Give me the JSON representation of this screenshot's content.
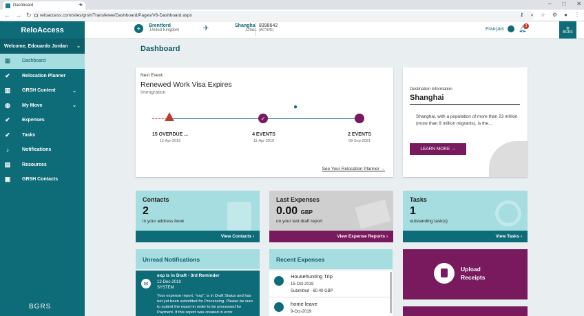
{
  "browser": {
    "tab_title": "Dashboard",
    "url": "reloaccess.com/sites/grsh/Transferee/Dashboard/Pages/V6-Dashboard.aspx"
  },
  "sidebar": {
    "brand": "ReloAccess",
    "welcome": "Welcome, Edouardo Jordan",
    "items": [
      {
        "label": "Dashboard",
        "icon": "dashboard-icon"
      },
      {
        "label": "Relocation Planner",
        "icon": "check-circle-icon"
      },
      {
        "label": "GRSH Content",
        "icon": "books-icon"
      },
      {
        "label": "My Move",
        "icon": "globe-icon"
      },
      {
        "label": "Expenses",
        "icon": "check-circle-icon"
      },
      {
        "label": "Tasks",
        "icon": "check-circle-icon"
      },
      {
        "label": "Notifications",
        "icon": "bell-icon"
      },
      {
        "label": "Resources",
        "icon": "book-icon"
      },
      {
        "label": "GRSH Contacts",
        "icon": "contact-icon"
      }
    ],
    "footer_logo": "BGRS"
  },
  "topbar": {
    "origin_city": "Brentford",
    "origin_country": ",United Kingdom",
    "dest_city": "Shanghai",
    "dest_country": ",China",
    "ref": "8398642",
    "status": "(ACTIVE)",
    "language": "Français",
    "notif_count": "2",
    "logo": "BGRS"
  },
  "page_title": "Dashboard",
  "next_event": {
    "label": "Next Event:",
    "title": "Renewed Work Visa Expires",
    "category": "Immigration",
    "stages": [
      {
        "count": "15 OVERDUE ...",
        "date": "12-Apr-2019"
      },
      {
        "count": "4 EVENTS",
        "date": "11-Apr-2019"
      },
      {
        "count": "2 EVENTS",
        "date": "09-Sep-2021"
      }
    ],
    "link": "See Your Relocation Planner"
  },
  "destination": {
    "label": "Destination Information",
    "city": "Shanghai",
    "desc": "Shanghai, with a population of more than 23 million (more than 9 million migrants), is the...",
    "button": "LEARN MORE"
  },
  "tiles": [
    {
      "title": "Contacts",
      "number": "2",
      "unit": "",
      "sub": "in your address book",
      "link": "View Contacts"
    },
    {
      "title": "Last Expenses",
      "number": "0.00",
      "unit": "GBP",
      "sub": "on your last draft report",
      "link": "View Expense Reports"
    },
    {
      "title": "Tasks",
      "number": "1",
      "unit": "",
      "sub": "outstanding task(s)",
      "link": "View Tasks"
    }
  ],
  "notifications": {
    "header": "Unread Notifications",
    "item_title": "exp is in Draft - 3rd Reminder",
    "item_date": "12-Dec-2019",
    "item_from": "SYSTEM",
    "item_body": "Your expense report, \"exp\", is in Draft Status and has not yet been submitted for Processing. Please be sure to submit the report in order to be processed for Payment. If this report was created in error"
  },
  "recent_expenses": {
    "header": "Recent Expenses",
    "items": [
      {
        "title": "Househunting Trip",
        "date": "15-Oct-2019",
        "status": "Submitted - 80.40 GBP"
      },
      {
        "title": "home leave",
        "date": "9-Oct-2019",
        "status": ""
      }
    ]
  },
  "upload": {
    "label1": "Upload",
    "label2": "Receipts"
  }
}
